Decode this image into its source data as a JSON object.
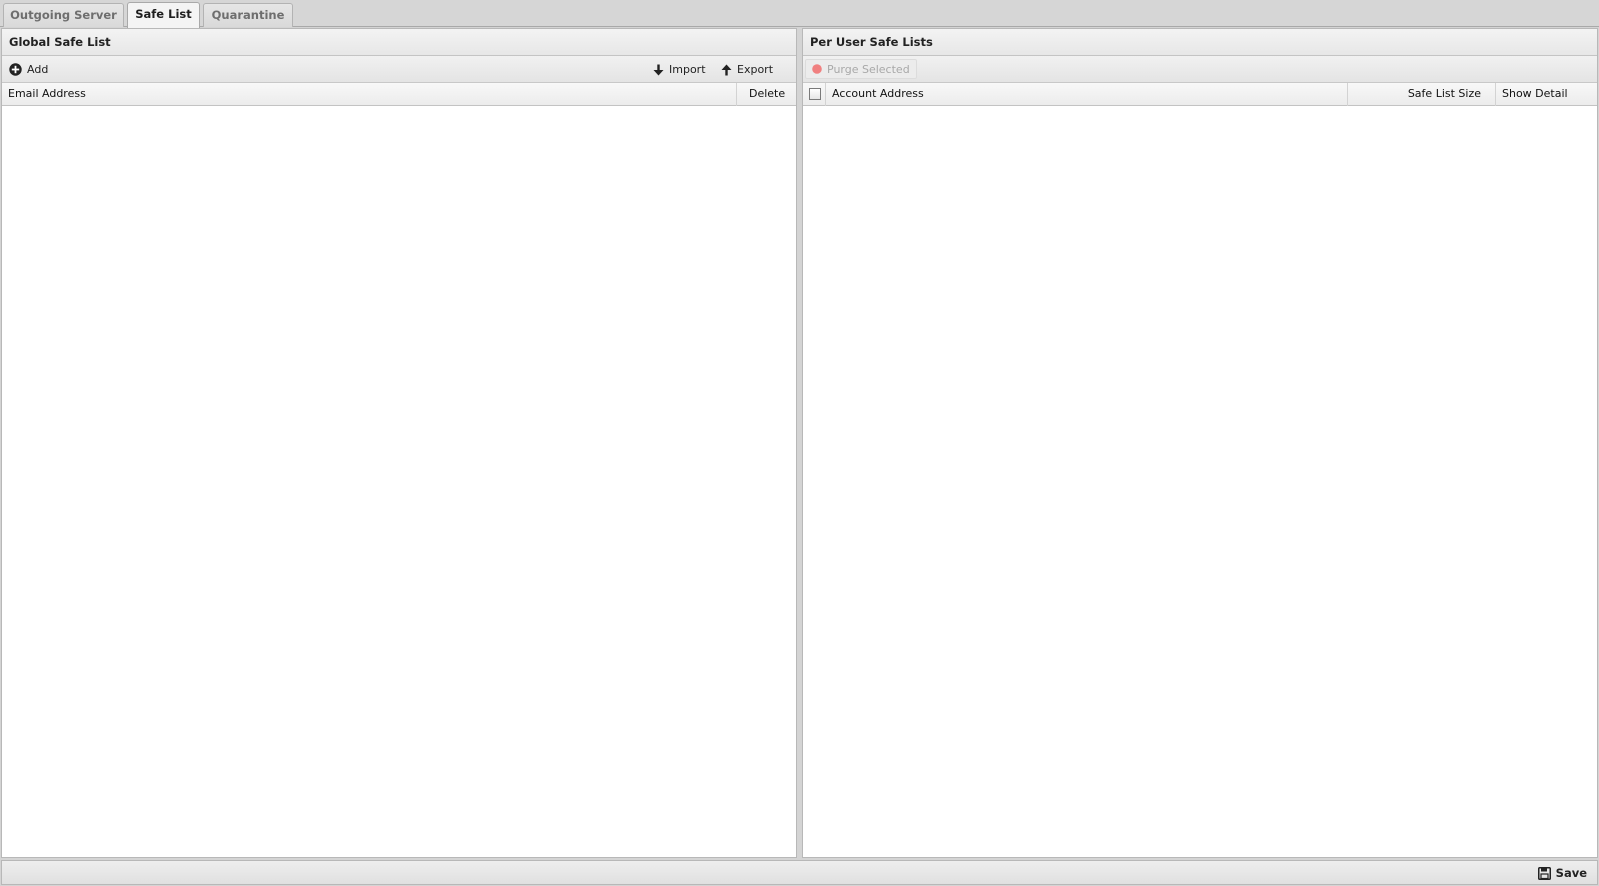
{
  "tabs": [
    {
      "label": "Outgoing Server",
      "active": false
    },
    {
      "label": "Safe List",
      "active": true
    },
    {
      "label": "Quarantine",
      "active": false
    }
  ],
  "global_panel": {
    "title": "Global Safe List",
    "toolbar": {
      "add_label": "Add",
      "import_label": "Import",
      "export_label": "Export"
    },
    "columns": {
      "email": "Email Address",
      "delete": "Delete"
    },
    "rows": []
  },
  "user_panel": {
    "title": "Per User Safe Lists",
    "toolbar": {
      "purge_label": "Purge Selected",
      "purge_enabled": false
    },
    "columns": {
      "account": "Account Address",
      "size": "Safe List Size",
      "detail": "Show Detail"
    },
    "rows": []
  },
  "footer": {
    "save_label": "Save"
  },
  "colors": {
    "purge_icon": "#f08080",
    "icon_dark": "#222222"
  }
}
